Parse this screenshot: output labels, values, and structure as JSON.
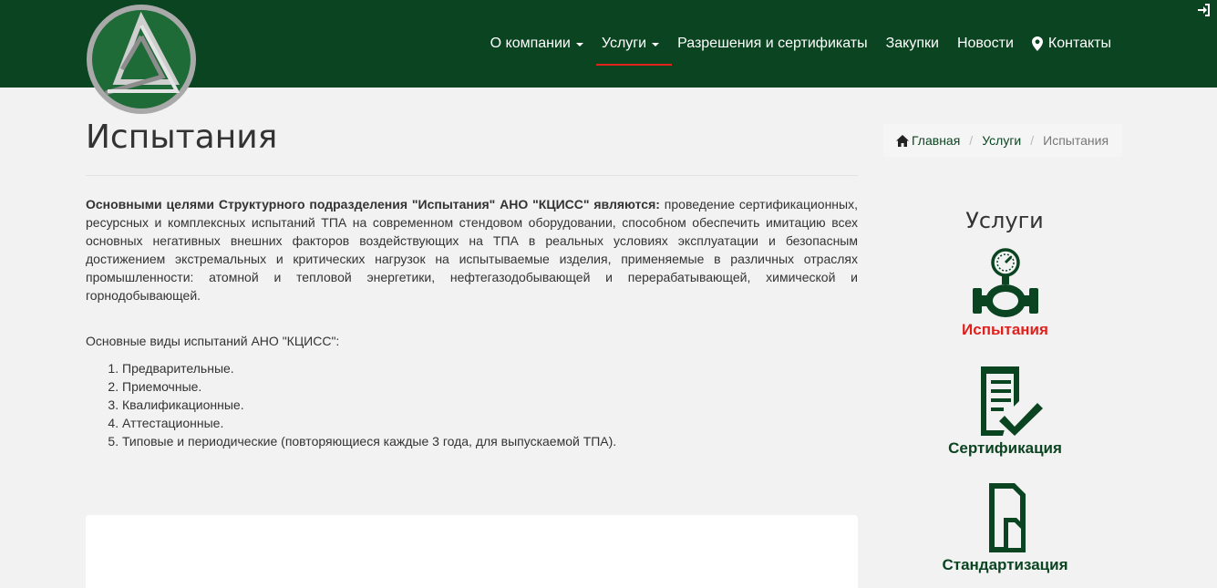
{
  "header": {
    "nav": [
      {
        "label": "О компании",
        "dropdown": true,
        "active": false
      },
      {
        "label": "Услуги",
        "dropdown": true,
        "active": true
      },
      {
        "label": "Разрешения и сертификаты",
        "dropdown": false,
        "active": false
      },
      {
        "label": "Закупки",
        "dropdown": false,
        "active": false
      },
      {
        "label": "Новости",
        "dropdown": false,
        "active": false
      },
      {
        "label": "Контакты",
        "dropdown": false,
        "active": false,
        "icon": "map-marker-icon"
      }
    ],
    "login_icon": "sign-in-icon"
  },
  "page": {
    "title": "Испытания"
  },
  "breadcrumb": {
    "home": "Главная",
    "services": "Услуги",
    "current": "Испытания"
  },
  "content": {
    "intro_bold": "Основными целями Структурного подразделения \"Испытания\" АНО \"КЦИСС\" являются:",
    "intro_text": " проведение сертификационных, ресурсных и комплексных испытаний ТПА на современном стендовом оборудовании, способном обеспечить имитацию всех основных негативных внешних факторов воздействующих на ТПА в реальных условиях эксплуатации и безопасным достижением  экстремальных и критических нагрузок на испытываемые изделия, применяемые в различных отраслях промышленности: атомной и тепловой энергетики, нефтегазодобывающей и перерабатывающей,  химической и горнодобывающей.",
    "types_title": "Основные виды испытаний АНО \"КЦИСС\":",
    "types": [
      "Предварительные.",
      "Приемочные.",
      "Квалификационные.",
      "Аттестационные.",
      "Типовые и периодические (повторяющиеся каждые 3 года, для выпускаемой ТПА)."
    ]
  },
  "sidebar": {
    "title": "Услуги",
    "services": [
      {
        "label": "Испытания",
        "icon": "valve-gauge-icon",
        "active": true
      },
      {
        "label": "Сертификация",
        "icon": "document-check-icon",
        "active": false
      },
      {
        "label": "Стандартизация",
        "icon": "document-icon",
        "active": false
      }
    ]
  },
  "colors": {
    "header_bg": "#0b4421",
    "accent_red": "#e0201c",
    "brand_green": "#0b4421"
  }
}
